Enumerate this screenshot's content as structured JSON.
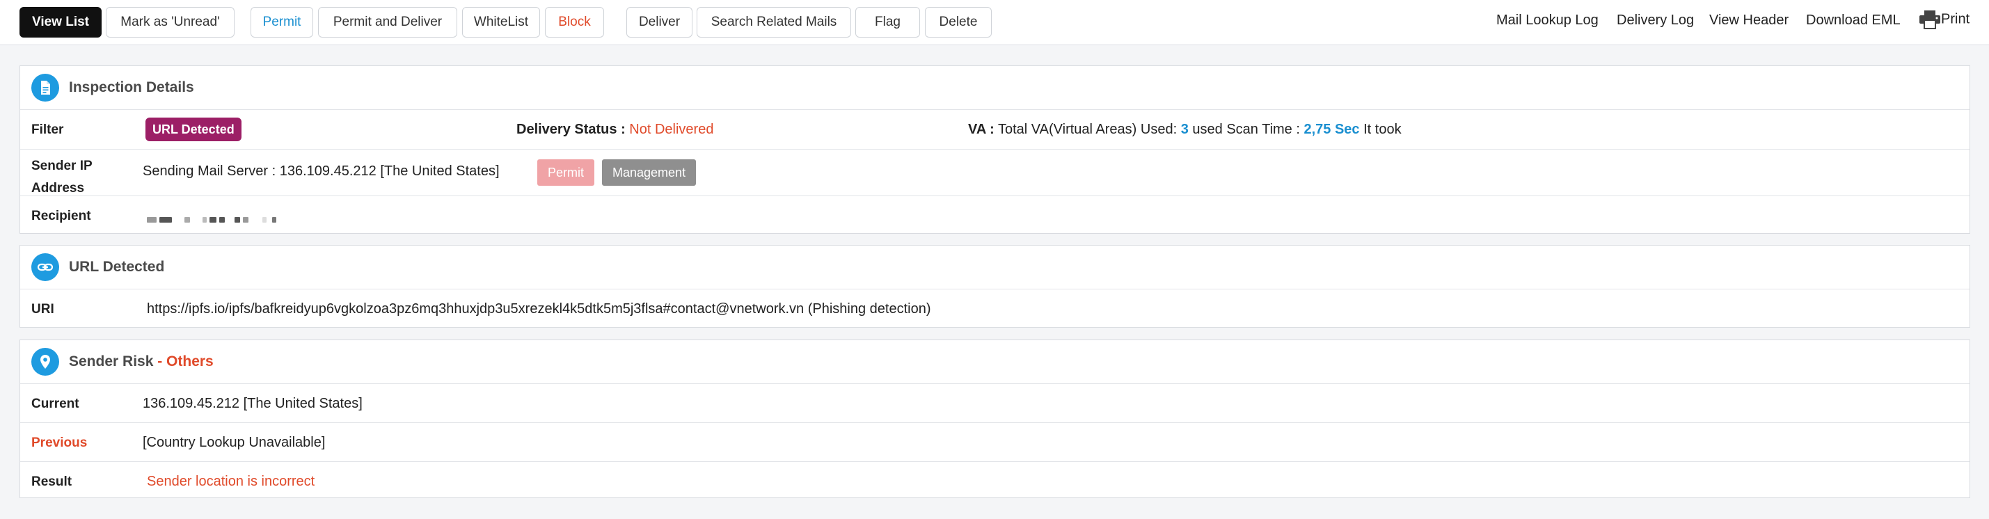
{
  "toolbar": {
    "view_list": "View List",
    "mark_unread": "Mark as 'Unread'",
    "permit": "Permit",
    "permit_deliver": "Permit and Deliver",
    "whitelist": "WhiteList",
    "block": "Block",
    "deliver": "Deliver",
    "search_related": "Search Related Mails",
    "flag": "Flag",
    "delete": "Delete",
    "mail_lookup_log": "Mail Lookup Log",
    "delivery_log": "Delivery Log",
    "view_header": "View Header",
    "download_eml": "Download EML",
    "print": "Print"
  },
  "inspection": {
    "title": "Inspection Details",
    "filter_label": "Filter",
    "filter_badge": "URL Detected",
    "delivery_status_label": "Delivery Status :",
    "delivery_status_value": "Not Delivered",
    "va_label": "VA :",
    "va_text_1": "Total VA(Virtual Areas) Used:",
    "va_count": "3",
    "va_text_2": "used Scan Time :",
    "scan_time": "2,75 Sec",
    "va_text_3": "It took",
    "sender_ip_label_1": "Sender IP",
    "sender_ip_label_2": "Address",
    "sending_server": "Sending Mail Server : 136.109.45.212 [The United States]",
    "permit_button": "Permit",
    "management_button": "Management",
    "recipient_label": "Recipient"
  },
  "url_detected": {
    "title": "URL Detected",
    "uri_label": "URI",
    "uri_value": "https://ipfs.io/ipfs/bafkreidyup6vgkolzoa3pz6mq3hhuxjdp3u5xrezekl4k5dtk5m5j3flsa#contact@vnetwork.vn (Phishing detection)"
  },
  "sender_risk": {
    "title": "Sender Risk",
    "title_suffix": " - Others",
    "current_label": "Current",
    "current_value": "136.109.45.212 [The United States]",
    "previous_label": "Previous",
    "previous_value": "[Country Lookup Unavailable]",
    "result_label": "Result",
    "result_value": "Sender location is incorrect"
  },
  "colors": {
    "accent_blue": "#1a8fd0",
    "alert_orange": "#e04a2a",
    "badge_purple": "#9c1f66",
    "icon_blue": "#1e9be0"
  },
  "icons": [
    "document-icon",
    "link-icon",
    "location-pin-icon",
    "printer-icon"
  ]
}
